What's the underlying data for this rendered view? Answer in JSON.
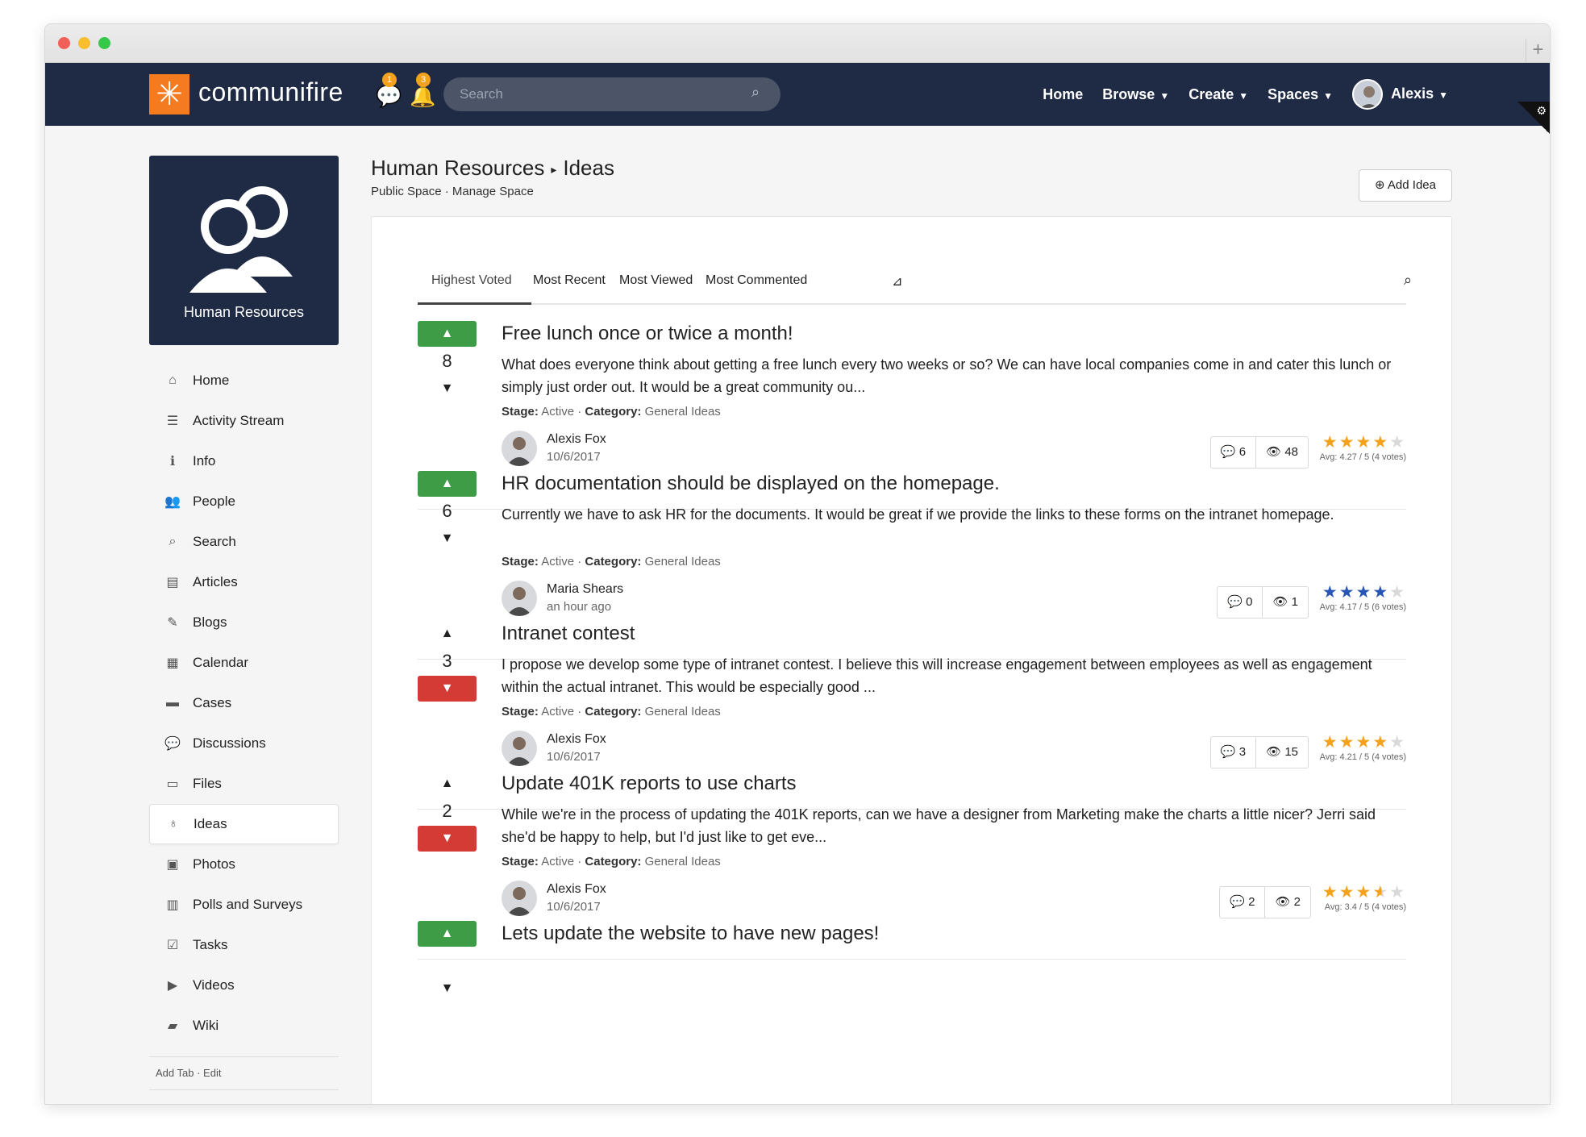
{
  "brand": {
    "logo_text": "communifire",
    "logo_glyph": "✳"
  },
  "notifications": {
    "messages_count": "1",
    "alerts_count": "3"
  },
  "search": {
    "placeholder": "Search"
  },
  "nav": {
    "home": "Home",
    "browse": "Browse",
    "create": "Create",
    "spaces": "Spaces",
    "user": "Alexis"
  },
  "space": {
    "name": "Human Resources"
  },
  "sidebar": {
    "items": [
      {
        "label": "Home",
        "icon": "home-icon",
        "glyph": "⌂"
      },
      {
        "label": "Activity Stream",
        "icon": "list-icon",
        "glyph": "☰"
      },
      {
        "label": "Info",
        "icon": "info-icon",
        "glyph": "ℹ"
      },
      {
        "label": "People",
        "icon": "people-icon",
        "glyph": "👥"
      },
      {
        "label": "Search",
        "icon": "search-icon",
        "glyph": "⌕"
      },
      {
        "label": "Articles",
        "icon": "article-icon",
        "glyph": "▤"
      },
      {
        "label": "Blogs",
        "icon": "blog-icon",
        "glyph": "✎"
      },
      {
        "label": "Calendar",
        "icon": "calendar-icon",
        "glyph": "▦"
      },
      {
        "label": "Cases",
        "icon": "briefcase-icon",
        "glyph": "▬"
      },
      {
        "label": "Discussions",
        "icon": "chat-icon",
        "glyph": "💬"
      },
      {
        "label": "Files",
        "icon": "folder-icon",
        "glyph": "▭"
      },
      {
        "label": "Ideas",
        "icon": "lightbulb-icon",
        "glyph": "♁"
      },
      {
        "label": "Photos",
        "icon": "image-icon",
        "glyph": "▣"
      },
      {
        "label": "Polls and Surveys",
        "icon": "chart-icon",
        "glyph": "▥"
      },
      {
        "label": "Tasks",
        "icon": "checkbox-icon",
        "glyph": "☑"
      },
      {
        "label": "Videos",
        "icon": "video-icon",
        "glyph": "▶"
      },
      {
        "label": "Wiki",
        "icon": "book-icon",
        "glyph": "▰"
      }
    ],
    "active": "Ideas",
    "footer_add": "Add Tab",
    "footer_edit": "Edit"
  },
  "header": {
    "space_title": "Human Resources",
    "section_title": "Ideas",
    "public_space": "Public Space",
    "manage_space": "Manage Space",
    "add_idea": "Add Idea"
  },
  "tabs": [
    "Highest Voted",
    "Most Recent",
    "Most Viewed",
    "Most Commented"
  ],
  "ideas": [
    {
      "title": "Free lunch once or twice a month!",
      "description": "What does everyone think about getting a free lunch every two weeks or so? We can have local companies come in and cater this lunch or simply just order out. It would be a great community ou...",
      "votes": "8",
      "voted": "up",
      "stage_label": "Stage:",
      "stage": "Active",
      "category_label": "Category:",
      "category": "General Ideas",
      "author": "Alexis Fox",
      "date": "10/6/2017",
      "comments": "6",
      "views": "48",
      "rating": 4.27,
      "star_color": "#f4a11d",
      "avg": "Avg: 4.27 / 5 (4 votes)"
    },
    {
      "title": "HR documentation should be displayed on the homepage.",
      "description": "Currently we have to ask HR for the documents. It would be great if we provide the links to these forms on the intranet homepage.",
      "votes": "6",
      "voted": "up",
      "stage_label": "Stage:",
      "stage": "Active",
      "category_label": "Category:",
      "category": "General Ideas",
      "author": "Maria Shears",
      "date": "an hour ago",
      "comments": "0",
      "views": "1",
      "rating": 4.17,
      "star_color": "#2956b3",
      "avg": "Avg: 4.17 / 5 (6 votes)"
    },
    {
      "title": "Intranet contest",
      "description": "I propose we develop some type of intranet contest. I believe this will increase engagement between employees as well as engagement within the actual intranet. This would be especially good ...",
      "votes": "3",
      "voted": "down",
      "stage_label": "Stage:",
      "stage": "Active",
      "category_label": "Category:",
      "category": "General Ideas",
      "author": "Alexis Fox",
      "date": "10/6/2017",
      "comments": "3",
      "views": "15",
      "rating": 4.21,
      "star_color": "#f4a11d",
      "avg": "Avg: 4.21 / 5 (4 votes)"
    },
    {
      "title": "Update 401K reports to use charts",
      "description": "While we're in the process of updating the 401K reports, can we have a designer from Marketing make the charts a little nicer? Jerri said she'd be happy to help, but I'd just like to get eve...",
      "votes": "2",
      "voted": "down",
      "stage_label": "Stage:",
      "stage": "Active",
      "category_label": "Category:",
      "category": "General Ideas",
      "author": "Alexis Fox",
      "date": "10/6/2017",
      "comments": "2",
      "views": "2",
      "rating": 3.4,
      "star_color": "#f4a11d",
      "avg": "Avg: 3.4 / 5 (4 votes)"
    },
    {
      "title": "Lets update the website to have new pages!",
      "description": "",
      "votes": "",
      "voted": "up",
      "stage_label": "",
      "stage": "",
      "category_label": "",
      "category": "",
      "author": "",
      "date": "",
      "comments": "",
      "views": "",
      "rating": 0,
      "star_color": "#f4a11d",
      "avg": ""
    }
  ]
}
